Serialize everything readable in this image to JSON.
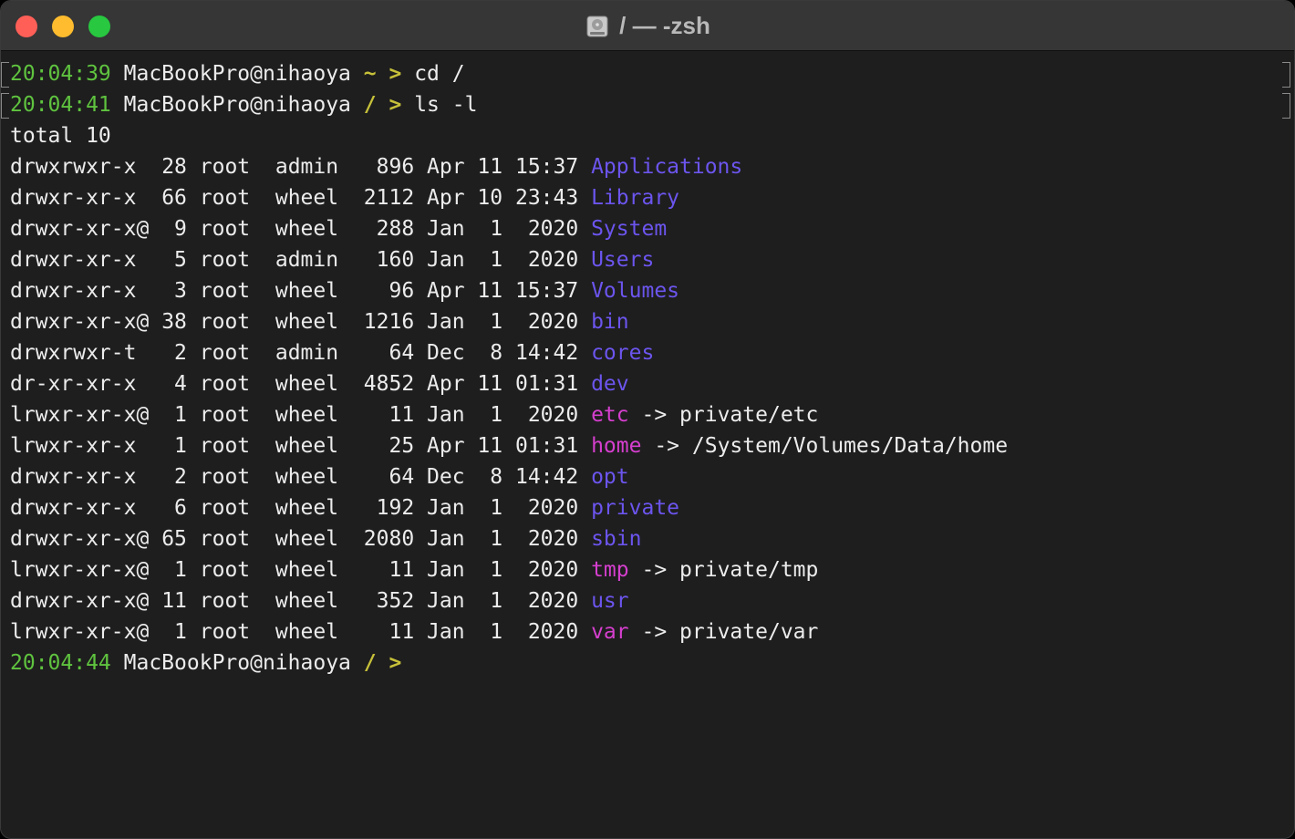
{
  "window": {
    "title": "/ — -zsh",
    "disk_icon": "disk-icon"
  },
  "colors": {
    "time": "#5fc33f",
    "prompt": "#c7c13a",
    "directory": "#6b55ee",
    "symlink": "#d63fcf",
    "text": "#ececec"
  },
  "prompts": [
    {
      "time": "20:04:39",
      "host": "MacBookPro@nihaoya",
      "cwd": "~",
      "arrow": ">",
      "command": "cd /"
    },
    {
      "time": "20:04:41",
      "host": "MacBookPro@nihaoya",
      "cwd": "/",
      "arrow": ">",
      "command": "ls -l"
    }
  ],
  "total": "total 10",
  "entries": [
    {
      "perms": "drwxrwxr-x ",
      "links": "28",
      "owner": "root",
      "group": "admin",
      "size": " 896",
      "date": "Apr 11 15:37",
      "name": "Applications",
      "kind": "dir",
      "target": ""
    },
    {
      "perms": "drwxr-xr-x ",
      "links": "66",
      "owner": "root",
      "group": "wheel",
      "size": "2112",
      "date": "Apr 10 23:43",
      "name": "Library",
      "kind": "dir",
      "target": ""
    },
    {
      "perms": "drwxr-xr-x@",
      "links": " 9",
      "owner": "root",
      "group": "wheel",
      "size": " 288",
      "date": "Jan  1  2020",
      "name": "System",
      "kind": "dir",
      "target": ""
    },
    {
      "perms": "drwxr-xr-x ",
      "links": " 5",
      "owner": "root",
      "group": "admin",
      "size": " 160",
      "date": "Jan  1  2020",
      "name": "Users",
      "kind": "dir",
      "target": ""
    },
    {
      "perms": "drwxr-xr-x ",
      "links": " 3",
      "owner": "root",
      "group": "wheel",
      "size": "  96",
      "date": "Apr 11 15:37",
      "name": "Volumes",
      "kind": "dir",
      "target": ""
    },
    {
      "perms": "drwxr-xr-x@",
      "links": "38",
      "owner": "root",
      "group": "wheel",
      "size": "1216",
      "date": "Jan  1  2020",
      "name": "bin",
      "kind": "dir",
      "target": ""
    },
    {
      "perms": "drwxrwxr-t ",
      "links": " 2",
      "owner": "root",
      "group": "admin",
      "size": "  64",
      "date": "Dec  8 14:42",
      "name": "cores",
      "kind": "dir",
      "target": ""
    },
    {
      "perms": "dr-xr-xr-x ",
      "links": " 4",
      "owner": "root",
      "group": "wheel",
      "size": "4852",
      "date": "Apr 11 01:31",
      "name": "dev",
      "kind": "dir",
      "target": ""
    },
    {
      "perms": "lrwxr-xr-x@",
      "links": " 1",
      "owner": "root",
      "group": "wheel",
      "size": "  11",
      "date": "Jan  1  2020",
      "name": "etc",
      "kind": "link",
      "target": "private/etc"
    },
    {
      "perms": "lrwxr-xr-x ",
      "links": " 1",
      "owner": "root",
      "group": "wheel",
      "size": "  25",
      "date": "Apr 11 01:31",
      "name": "home",
      "kind": "link",
      "target": "/System/Volumes/Data/home"
    },
    {
      "perms": "drwxr-xr-x ",
      "links": " 2",
      "owner": "root",
      "group": "wheel",
      "size": "  64",
      "date": "Dec  8 14:42",
      "name": "opt",
      "kind": "dir",
      "target": ""
    },
    {
      "perms": "drwxr-xr-x ",
      "links": " 6",
      "owner": "root",
      "group": "wheel",
      "size": " 192",
      "date": "Jan  1  2020",
      "name": "private",
      "kind": "dir",
      "target": ""
    },
    {
      "perms": "drwxr-xr-x@",
      "links": "65",
      "owner": "root",
      "group": "wheel",
      "size": "2080",
      "date": "Jan  1  2020",
      "name": "sbin",
      "kind": "dir",
      "target": ""
    },
    {
      "perms": "lrwxr-xr-x@",
      "links": " 1",
      "owner": "root",
      "group": "wheel",
      "size": "  11",
      "date": "Jan  1  2020",
      "name": "tmp",
      "kind": "link",
      "target": "private/tmp"
    },
    {
      "perms": "drwxr-xr-x@",
      "links": "11",
      "owner": "root",
      "group": "wheel",
      "size": " 352",
      "date": "Jan  1  2020",
      "name": "usr",
      "kind": "dir",
      "target": ""
    },
    {
      "perms": "lrwxr-xr-x@",
      "links": " 1",
      "owner": "root",
      "group": "wheel",
      "size": "  11",
      "date": "Jan  1  2020",
      "name": "var",
      "kind": "link",
      "target": "private/var"
    }
  ],
  "link_arrow": "->",
  "current_prompt": {
    "time": "20:04:44",
    "host": "MacBookPro@nihaoya",
    "cwd": "/",
    "arrow": ">"
  }
}
